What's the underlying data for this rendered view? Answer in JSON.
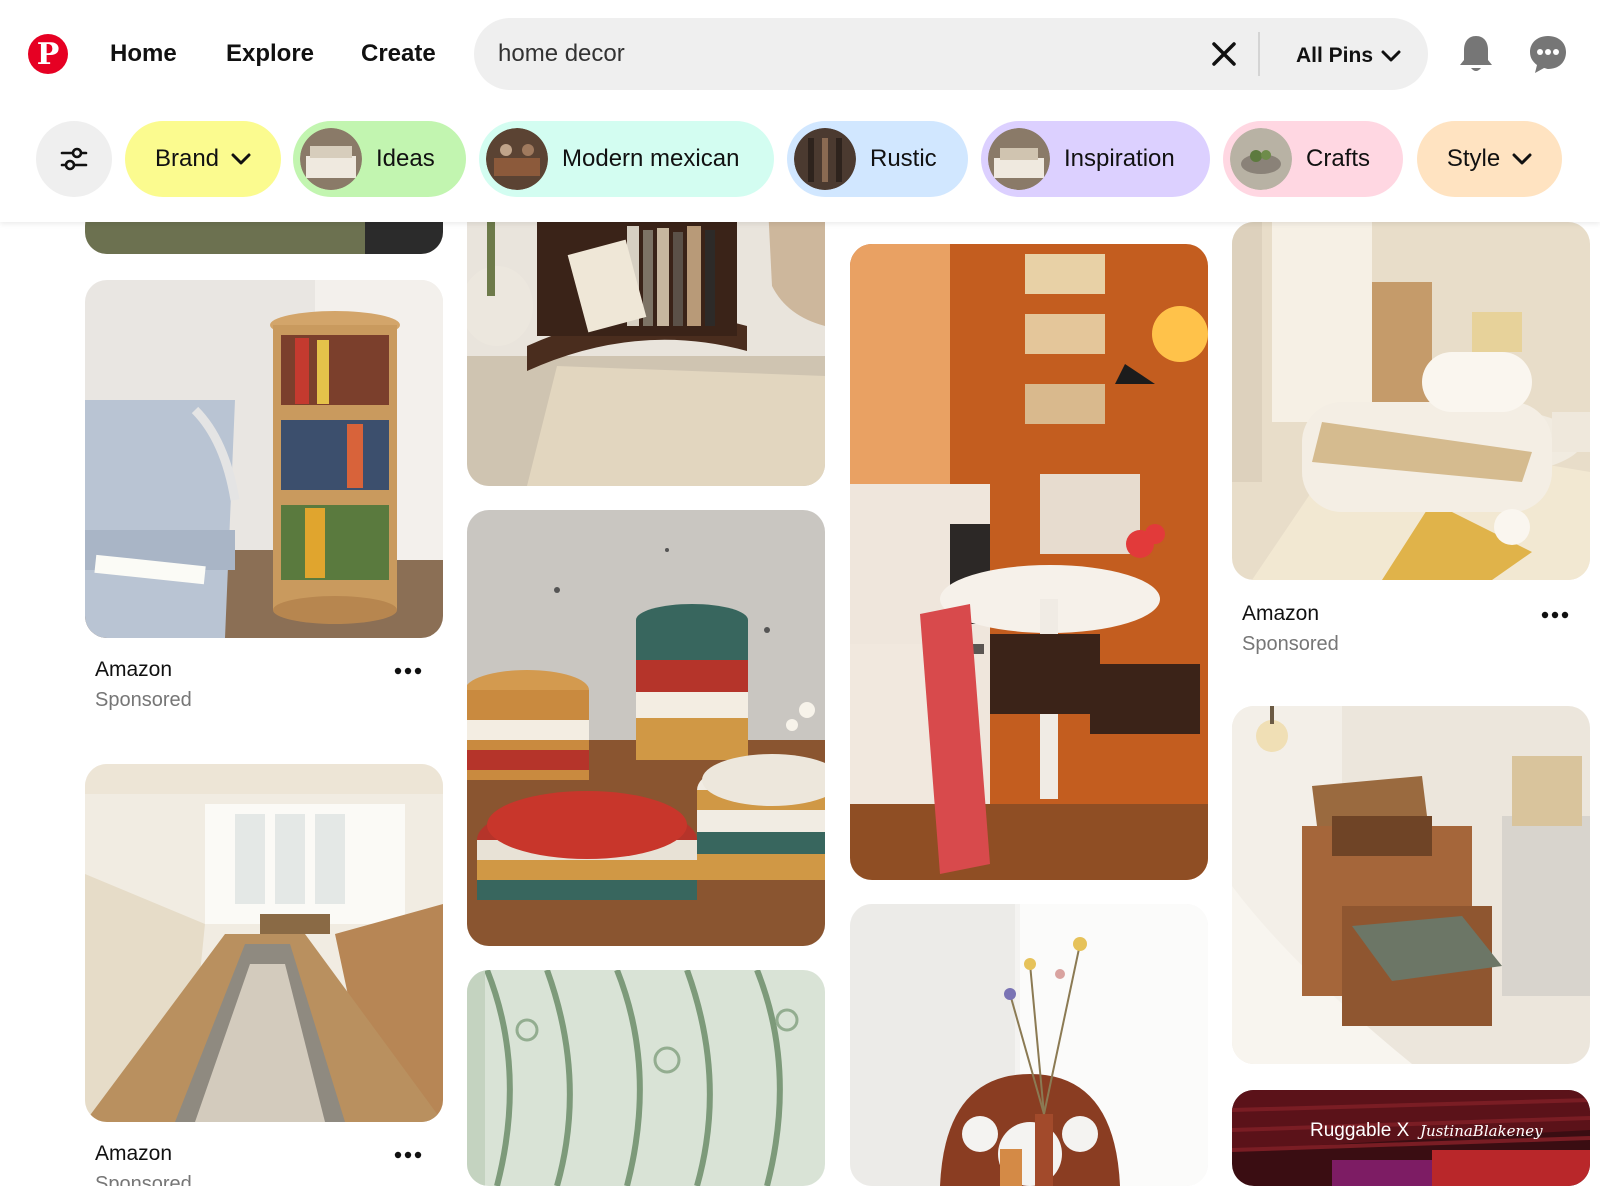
{
  "nav": {
    "home": "Home",
    "explore": "Explore",
    "create": "Create"
  },
  "search": {
    "query": "home decor",
    "scope": "All Pins"
  },
  "filters": [
    {
      "label": "Brand",
      "color": "#fbfb8f",
      "dropdown": true
    },
    {
      "label": "Ideas",
      "color": "#c2f5b0",
      "dropdown": false
    },
    {
      "label": "Modern mexican",
      "color": "#d3fdf1",
      "dropdown": false
    },
    {
      "label": "Rustic",
      "color": "#d1e7ff",
      "dropdown": false
    },
    {
      "label": "Inspiration",
      "color": "#dcd0ff",
      "dropdown": false
    },
    {
      "label": "Crafts",
      "color": "#ffd7e2",
      "dropdown": false
    },
    {
      "label": "Style",
      "color": "#ffe3c1",
      "dropdown": true
    }
  ],
  "pins": {
    "bookshelf": {
      "source": "Amazon",
      "sponsored": "Sponsored"
    },
    "bedroom": {
      "source": "Amazon",
      "sponsored": "Sponsored"
    },
    "kitchen": {
      "source": "Amazon",
      "sponsored": "Sponsored"
    },
    "ruggable_brand": "Ruggable X",
    "ruggable_signature": "JustinaBlakeney"
  },
  "colors": {
    "brand": "#e60023",
    "icon": "#767676"
  }
}
